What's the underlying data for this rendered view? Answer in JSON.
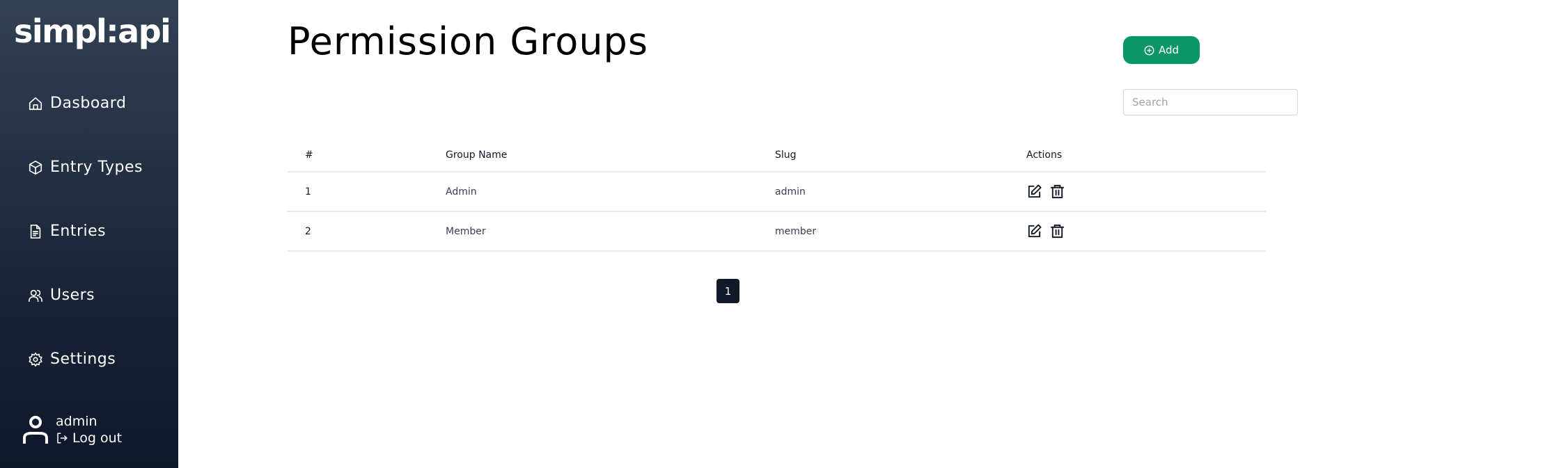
{
  "app": {
    "logo": "simpl:api"
  },
  "sidebar": {
    "items": [
      {
        "label": "Dasboard",
        "icon": "home-icon"
      },
      {
        "label": "Entry Types",
        "icon": "cube-icon"
      },
      {
        "label": "Entries",
        "icon": "document-icon"
      },
      {
        "label": "Users",
        "icon": "users-icon"
      },
      {
        "label": "Settings",
        "icon": "gear-icon"
      }
    ],
    "user": {
      "name": "admin",
      "logout_label": "Log out"
    }
  },
  "header": {
    "title": "Permission Groups",
    "add_label": "Add",
    "search_placeholder": "Search",
    "search_value": ""
  },
  "table": {
    "columns": [
      "#",
      "Group Name",
      "Slug",
      "Actions"
    ],
    "rows": [
      {
        "id": "1",
        "name": "Admin",
        "slug": "admin"
      },
      {
        "id": "2",
        "name": "Member",
        "slug": "member"
      }
    ]
  },
  "pagination": {
    "current_page": "1"
  },
  "colors": {
    "accent": "#0b9668",
    "sidebar_top": "#334155",
    "sidebar_bottom": "#0f172a",
    "page_active": "#111827"
  }
}
